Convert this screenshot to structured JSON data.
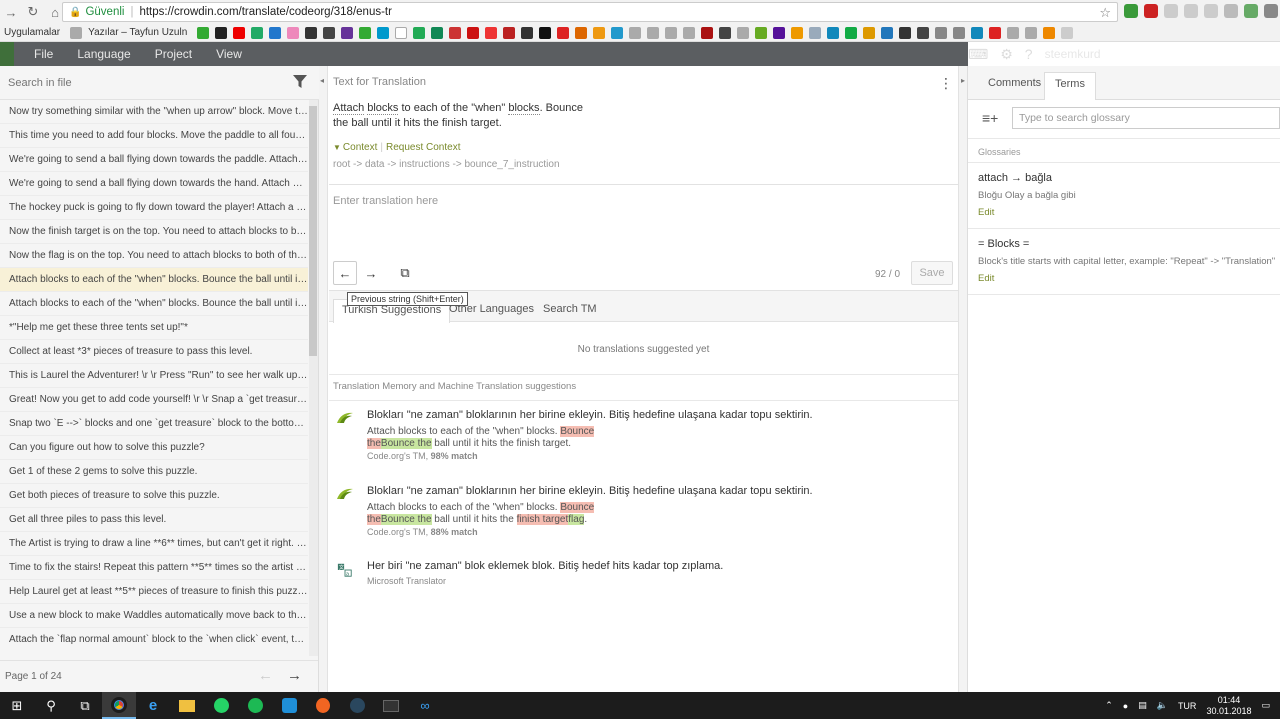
{
  "browser": {
    "secure_label": "Güvenli",
    "url": "https://crowdin.com/translate/codeorg/318/enus-tr"
  },
  "bookmarks": {
    "apps_label": "Uygulamalar",
    "item1": "Yazılar – Tayfun Uzuln"
  },
  "menubar": {
    "file": "File",
    "language": "Language",
    "project": "Project",
    "view": "View",
    "user": "steemkurd"
  },
  "left": {
    "search_placeholder": "Search in file",
    "items": [
      "Now try something similar with the \"when up arrow\" block. Move the paddle...",
      "This time you need to add four blocks. Move the paddle to all four fi...",
      "We're going to send a ball flying down towards the paddle. Attach a ...",
      "We're going to send a ball flying down towards the hand. Attach a bl...",
      "The hockey puck is going to fly down toward the player! Attach a blo...",
      "Now the finish target is on the top. You need to attach blocks to bot...",
      "Now the flag is on the top. You need to attach blocks to both of the \"...",
      "Attach blocks to each of the \"when\" blocks. Bounce the ball until it hi...",
      "Attach blocks to each of the \"when\" blocks. Bounce the ball until it hi...",
      "*\"Help me get these three tents set up!\"*",
      "Collect at least *3* pieces of treasure to pass this level.",
      "This is Laurel the Adventurer! \\r \\r Press \"Run\" to see her walk up to ...",
      "Great! Now you get to add code yourself! \\r \\r Snap a `get treasure`...",
      "Snap two `E -->` blocks and one `get treasure` block to the bottom...",
      "Can you figure out how to solve this puzzle?",
      "Get 1 of these 2 gems to solve this puzzle.",
      "Get both pieces of treasure to solve this puzzle.",
      "Get all three piles to pass this level.",
      "The Artist is trying to draw a line **6** times, but can't get it right. C...",
      "Time to fix the stairs! Repeat this pattern **5** times so the artist c...",
      "Help Laurel get at least **5** pieces of treasure to finish this puzzle.",
      "Use a new block to make Waddles automatically move back to the st...",
      "Attach the `flap normal amount` block to the `when click` event, th..."
    ],
    "pager": "Page 1 of 24"
  },
  "center": {
    "label": "Text for Translation",
    "source_w1": "Attach",
    "source_w2": "blocks",
    "source_rest1": " to each of the \"when\" ",
    "source_w3": "blocks",
    "source_rest2": ". Bounce",
    "source_line2": "the ball until it hits the finish target.",
    "context": "Context",
    "request_context": "Request Context",
    "crumbs": "root -> data -> instructions -> bounce_7_instruction",
    "translation_placeholder": "Enter translation here",
    "counter": "92 / 0",
    "save": "Save",
    "tooltip": "Previous string (Shift+Enter)",
    "tabs": [
      "Turkish Suggestions",
      "Other Languages",
      "Search TM"
    ],
    "no_suggestions": "No translations suggested yet",
    "tm_label": "Translation Memory and Machine Translation suggestions",
    "sugg1": {
      "translation": "Blokları \"ne zaman\" bloklarının her birine ekleyin. Bitiş hedefine ulaşana kadar topu sektirin.",
      "src_a": "Attach blocks to each of the \"when\" blocks. ",
      "src_del1": "Bounce",
      "src_del2": "the",
      "src_ins": "Bounce the",
      "src_b": " ball until it hits the finish target.",
      "meta_a": "Code.org's TM, ",
      "meta_b": "98% match"
    },
    "sugg2": {
      "translation": "Blokları \"ne zaman\" bloklarının her birine ekleyin. Bitiş hedefine ulaşana kadar topu sektirin.",
      "src_a": "Attach blocks to each of the \"when\" blocks. ",
      "src_del1": "Bounce",
      "src_del2": "the",
      "src_ins": "Bounce the",
      "src_b": " ball until it hits the ",
      "src_del3": "finish target",
      "src_ins2": "flag",
      "src_c": ".",
      "meta_a": "Code.org's TM, ",
      "meta_b": "88% match"
    },
    "sugg3": {
      "translation": "Her biri \"ne zaman\" blok eklemek blok. Bitiş hedef hits kadar top zıplama.",
      "meta": "Microsoft Translator"
    }
  },
  "right": {
    "tabs": [
      "Comments",
      "Terms"
    ],
    "search_placeholder": "Type to search glossary",
    "glossaries": "Glossaries",
    "term1_title": "attach → bağla",
    "term1_desc": "Bloğu Olay a bağla gibi",
    "term2_title": "= Blocks =",
    "term2_desc": "Block's title starts with capital letter, example: \"Repeat\" -> \"Translation\"",
    "edit": "Edit"
  },
  "taskbar": {
    "lang": "TUR",
    "time": "01:44",
    "date": "30.01.2018"
  }
}
